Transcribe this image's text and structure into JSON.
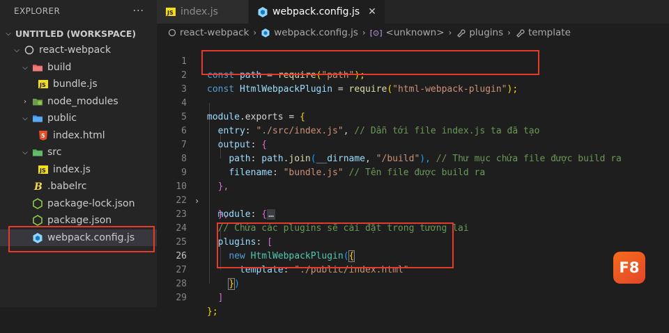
{
  "explorer": {
    "title": "EXPLORER",
    "more": "···",
    "workspace": "UNTITLED (WORKSPACE)",
    "tree": [
      {
        "label": "react-webpack",
        "icon": "folder-circle-icon"
      },
      {
        "label": "build",
        "icon": "folder-icon"
      },
      {
        "label": "bundle.js",
        "icon": "js-file-icon"
      },
      {
        "label": "node_modules",
        "icon": "node-folder-icon"
      },
      {
        "label": "public",
        "icon": "public-folder-icon"
      },
      {
        "label": "index.html",
        "icon": "html-file-icon"
      },
      {
        "label": "src",
        "icon": "src-folder-icon"
      },
      {
        "label": "index.js",
        "icon": "js-file-icon"
      },
      {
        "label": ".babelrc",
        "icon": "babel-icon"
      },
      {
        "label": "package-lock.json",
        "icon": "npm-icon"
      },
      {
        "label": "package.json",
        "icon": "npm-icon"
      },
      {
        "label": "webpack.config.js",
        "icon": "webpack-icon"
      }
    ]
  },
  "tabs": [
    {
      "label": "index.js",
      "icon": "js-file-icon"
    },
    {
      "label": "webpack.config.js",
      "icon": "webpack-icon",
      "close": "✕"
    }
  ],
  "breadcrumb": [
    "react-webpack",
    "webpack.config.js",
    "<unknown>",
    "plugins",
    "template"
  ],
  "line_numbers": [
    "1",
    "2",
    "3",
    "4",
    "5",
    "6",
    "7",
    "8",
    "9",
    "10",
    "22",
    "23",
    "24",
    "25",
    "26",
    "27",
    "28",
    "29"
  ],
  "code": {
    "l1_kw": "const",
    "l1_var": "path",
    "l1_eq": " = ",
    "l1_fn": "require",
    "l1_str": "\"path\"",
    "l1_end": ");",
    "l2_kw": "const",
    "l2_cls": "HtmlWebpackPlugin",
    "l2_eq": " = ",
    "l2_fn": "require",
    "l2_str": "\"html-webpack-plugin\"",
    "l2_end": ");",
    "l4_a": "module",
    "l4_b": ".exports = ",
    "l4_c": "{",
    "l5_a": "entry",
    "l5_b": ": ",
    "l5_c": "\"./src/index.js\"",
    "l5_d": ", ",
    "l5_e": "// Dẫn tới file index.js ta đã tạo",
    "l6_a": "output",
    "l6_b": ": ",
    "l6_c": "{",
    "l7_a": "path",
    "l7_b": ": ",
    "l7_c": "path",
    "l7_d": ".",
    "l7_e": "join",
    "l7_f": "(",
    "l7_g": "__dirname",
    "l7_h": ", ",
    "l7_i": "\"/build\"",
    "l7_j": "), ",
    "l7_k": "// Thư mục chứa file được build ra",
    "l8_a": "filename",
    "l8_b": ": ",
    "l8_c": "\"bundle.js\"",
    "l8_d": " ",
    "l8_e": "// Tên file được build ra",
    "l9_a": "},",
    "l10_a": "module",
    "l10_b": ": ",
    "l10_c": "{",
    "l10_d": "…",
    "l22_a": "},",
    "l23_a": "// Chứa các plugins sẽ cài đặt trong tương lai",
    "l24_a": "plugins",
    "l24_b": ": ",
    "l24_c": "[",
    "l25_a": "new",
    "l25_b": " ",
    "l25_c": "HtmlWebpackPlugin",
    "l25_d": "(",
    "l25_e": "{",
    "l26_a": "template",
    "l26_b": ": ",
    "l26_c": "\"./public/index.html\"",
    "l27_a": "}",
    "l27_b": ")",
    "l28_a": "]",
    "l29_a": "};"
  },
  "fold_marker": "›",
  "logo_text": "F8",
  "colors": {
    "highlight": "#e53b2c",
    "webpack": "#8ed6fb",
    "js": "#f5de19",
    "html": "#e44d26"
  }
}
